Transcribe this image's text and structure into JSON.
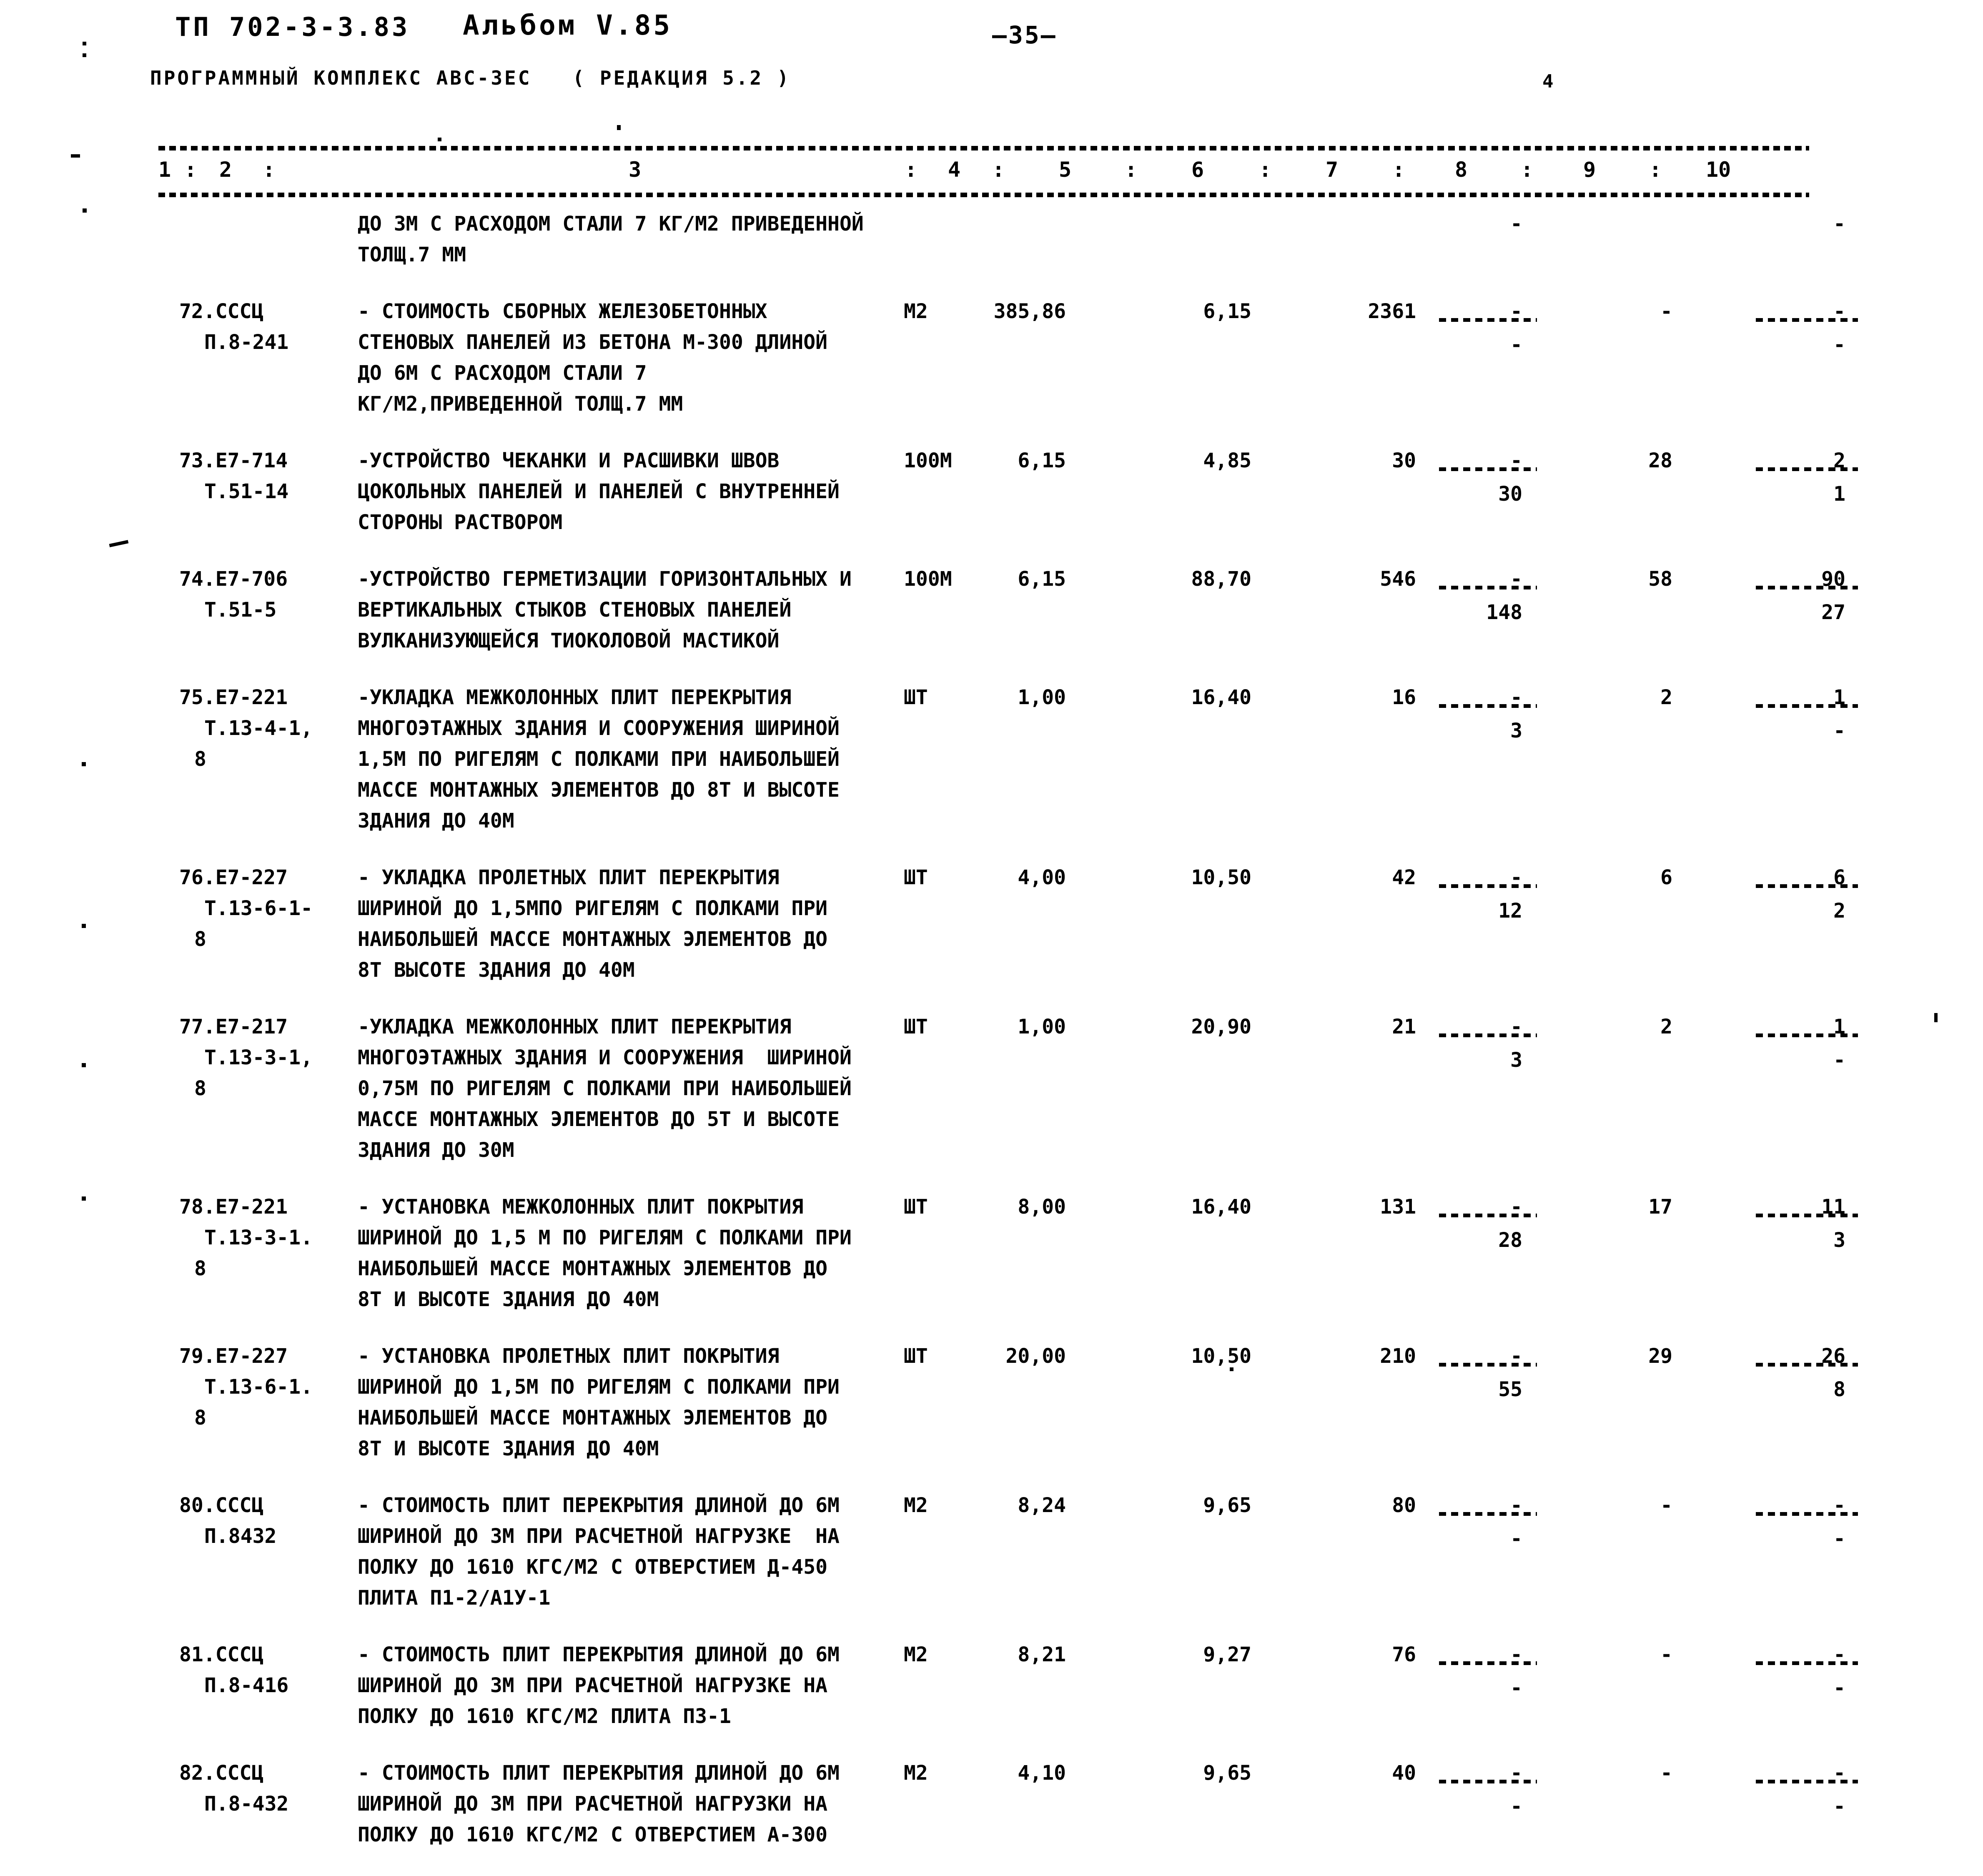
{
  "header": {
    "doc_code": "ТП 702-3-3.83",
    "album": "Альбом V.85",
    "page_number": "—35—",
    "subtitle": "ПРОГРАММНЫЙ КОМПЛЕКС АВС-ЗЕС   ( РЕДАКЦИЯ 5.2 )",
    "revision_mark": "4"
  },
  "table": {
    "column_numbers": [
      "1",
      ":",
      "2",
      ":",
      "3",
      ":",
      "4",
      ":",
      "5",
      ":",
      "6",
      ":",
      "7",
      ":",
      "8",
      ":",
      "9",
      ":",
      "10"
    ],
    "continued_row": {
      "desc": [
        "ДО 3М С РАСХОДОМ СТАЛИ 7 КГ/М2 ПРИВЕДЕННОЙ",
        "ТОЛЩ.7 ММ"
      ],
      "c8": "-",
      "c10": "-"
    },
    "rows": [
      {
        "code1": "72.СССЦ",
        "code2": "П.8-241",
        "code3": "",
        "desc": [
          "- СТОИМОСТЬ СБОРНЫХ ЖЕЛЕЗОБЕТОННЫХ",
          "СТЕНОВЫХ ПАНЕЛЕЙ ИЗ БЕТОНА М-300 ДЛИНОЙ",
          "ДО 6М С РАСХОДОМ СТАЛИ 7",
          "КГ/М2,ПРИВЕДЕННОЙ ТОЛЩ.7 ММ"
        ],
        "unit": "М2",
        "qty": "385,86",
        "price": "6,15",
        "total": "2361",
        "c8": "-",
        "c8b": "-",
        "c9": "-",
        "c10": "-",
        "c10b": "-"
      },
      {
        "code1": "73.Е7-714",
        "code2": "Т.51-14",
        "code3": "",
        "desc": [
          "-УСТРОЙСТВО ЧЕКАНКИ И РАСШИВКИ ШВОВ",
          "ЦОКОЛЬНЫХ ПАНЕЛЕЙ И ПАНЕЛЕЙ С ВНУТРЕННЕЙ",
          "СТОРОНЫ РАСТВОРОМ"
        ],
        "unit": "100М",
        "qty": "6,15",
        "price": "4,85",
        "total": "30",
        "c8": "-",
        "c8b": "30",
        "c9": "28",
        "c10": "2",
        "c10b": "1"
      },
      {
        "code1": "74.Е7-706",
        "code2": "Т.51-5",
        "code3": "",
        "desc": [
          "-УСТРОЙСТВО ГЕРМЕТИЗАЦИИ ГОРИЗОНТАЛЬНЫХ И",
          "ВЕРТИКАЛЬНЫХ СТЫКОВ СТЕНОВЫХ ПАНЕЛЕЙ",
          "ВУЛКАНИЗУЮЩЕЙСЯ ТИОКОЛОВОЙ МАСТИКОЙ"
        ],
        "unit": "100М",
        "qty": "6,15",
        "price": "88,70",
        "total": "546",
        "c8": "-",
        "c8b": "148",
        "c9": "58",
        "c10": "90",
        "c10b": "27"
      },
      {
        "code1": "75.Е7-221",
        "code2": "Т.13-4-1,",
        "code3": "8",
        "desc": [
          "-УКЛАДКА МЕЖКОЛОННЫХ ПЛИТ ПЕРЕКРЫТИЯ",
          "МНОГОЭТАЖНЫХ ЗДАНИЯ И СООРУЖЕНИЯ ШИРИНОЙ",
          "1,5М ПО РИГЕЛЯМ С ПОЛКАМИ ПРИ НАИБОЛЬШЕЙ",
          "МАССЕ МОНТАЖНЫХ ЭЛЕМЕНТОВ ДО 8Т И ВЫСОТЕ",
          "ЗДАНИЯ ДО 40М"
        ],
        "unit": "ШТ",
        "qty": "1,00",
        "price": "16,40",
        "total": "16",
        "c8": "-",
        "c8b": "3",
        "c9": "2",
        "c10": "1",
        "c10b": "-"
      },
      {
        "code1": "76.Е7-227",
        "code2": "Т.13-6-1-",
        "code3": "8",
        "desc": [
          "- УКЛАДКА ПРОЛЕТНЫХ ПЛИТ ПЕРЕКРЫТИЯ",
          "ШИРИНОЙ ДО 1,5МПО РИГЕЛЯМ С ПОЛКАМИ ПРИ",
          "НАИБОЛЬШЕЙ МАССЕ МОНТАЖНЫХ ЭЛЕМЕНТОВ ДО",
          "8Т ВЫСОТЕ ЗДАНИЯ ДО 40М"
        ],
        "unit": "ШТ",
        "qty": "4,00",
        "price": "10,50",
        "total": "42",
        "c8": "-",
        "c8b": "12",
        "c9": "6",
        "c10": "6",
        "c10b": "2"
      },
      {
        "code1": "77.Е7-217",
        "code2": "Т.13-3-1,",
        "code3": "8",
        "desc": [
          "-УКЛАДКА МЕЖКОЛОННЫХ ПЛИТ ПЕРЕКРЫТИЯ",
          "МНОГОЭТАЖНЫХ ЗДАНИЯ И СООРУЖЕНИЯ  ШИРИНОЙ",
          "0,75М ПО РИГЕЛЯМ С ПОЛКАМИ ПРИ НАИБОЛЬШЕЙ",
          "МАССЕ МОНТАЖНЫХ ЭЛЕМЕНТОВ ДО 5Т И ВЫСОТЕ",
          "ЗДАНИЯ ДО 30М"
        ],
        "unit": "ШТ",
        "qty": "1,00",
        "price": "20,90",
        "total": "21",
        "c8": "-",
        "c8b": "3",
        "c9": "2",
        "c10": "1",
        "c10b": "-"
      },
      {
        "code1": "78.Е7-221",
        "code2": "Т.13-3-1.",
        "code3": "8",
        "desc": [
          "- УСТАНОВКА МЕЖКОЛОННЫХ ПЛИТ ПОКРЫТИЯ",
          "ШИРИНОЙ ДО 1,5 М ПО РИГЕЛЯМ С ПОЛКАМИ ПРИ",
          "НАИБОЛЬШЕЙ МАССЕ МОНТАЖНЫХ ЭЛЕМЕНТОВ ДО",
          "8Т И ВЫСОТЕ ЗДАНИЯ ДО 40М"
        ],
        "unit": "ШТ",
        "qty": "8,00",
        "price": "16,40",
        "total": "131",
        "c8": "-",
        "c8b": "28",
        "c9": "17",
        "c10": "11",
        "c10b": "3"
      },
      {
        "code1": "79.Е7-227",
        "code2": "Т.13-6-1.",
        "code3": "8",
        "desc": [
          "- УСТАНОВКА ПРОЛЕТНЫХ ПЛИТ ПОКРЫТИЯ",
          "ШИРИНОЙ ДО 1,5М ПО РИГЕЛЯМ С ПОЛКАМИ ПРИ",
          "НАИБОЛЬШЕЙ МАССЕ МОНТАЖНЫХ ЭЛЕМЕНТОВ ДО",
          "8Т И ВЫСОТЕ ЗДАНИЯ ДО 40М"
        ],
        "unit": "ШТ",
        "qty": "20,00",
        "price": "10,50",
        "total": "210",
        "c8": "-",
        "c8b": "55",
        "c9": "29",
        "c10": "26",
        "c10b": "8"
      },
      {
        "code1": "80.СССЦ",
        "code2": "П.8432",
        "code3": "",
        "desc": [
          "- СТОИМОСТЬ ПЛИТ ПЕРЕКРЫТИЯ ДЛИНОЙ ДО 6М",
          "ШИРИНОЙ ДО 3М ПРИ РАСЧЕТНОЙ НАГРУЗКЕ  НА",
          "ПОЛКУ ДО 1610 КГС/М2 С ОТВЕРСТИЕМ Д-450",
          "ПЛИТА П1-2/А1У-1"
        ],
        "unit": "М2",
        "qty": "8,24",
        "price": "9,65",
        "total": "80",
        "c8": "-",
        "c8b": "-",
        "c9": "-",
        "c10": "-",
        "c10b": "-"
      },
      {
        "code1": "81.СССЦ",
        "code2": "П.8-416",
        "code3": "",
        "desc": [
          "- СТОИМОСТЬ ПЛИТ ПЕРЕКРЫТИЯ ДЛИНОЙ ДО 6М",
          "ШИРИНОЙ ДО 3М ПРИ РАСЧЕТНОЙ НАГРУЗКЕ НА",
          "ПОЛКУ ДО 1610 КГС/М2 ПЛИТА П3-1"
        ],
        "unit": "М2",
        "qty": "8,21",
        "price": "9,27",
        "total": "76",
        "c8": "-",
        "c8b": "-",
        "c9": "-",
        "c10": "-",
        "c10b": "-"
      },
      {
        "code1": "82.СССЦ",
        "code2": "П.8-432",
        "code3": "",
        "desc": [
          "- СТОИМОСТЬ ПЛИТ ПЕРЕКРЫТИЯ ДЛИНОЙ ДО 6М",
          "ШИРИНОЙ ДО 3М ПРИ РАСЧЕТНОЙ НАГРУЗКИ НА",
          "ПОЛКУ ДО 1610 КГС/М2 С ОТВЕРСТИЕМ А-300"
        ],
        "unit": "М2",
        "qty": "4,10",
        "price": "9,65",
        "total": "40",
        "c8": "-",
        "c8b": "-",
        "c9": "-",
        "c10": "-",
        "c10b": "-"
      }
    ]
  }
}
